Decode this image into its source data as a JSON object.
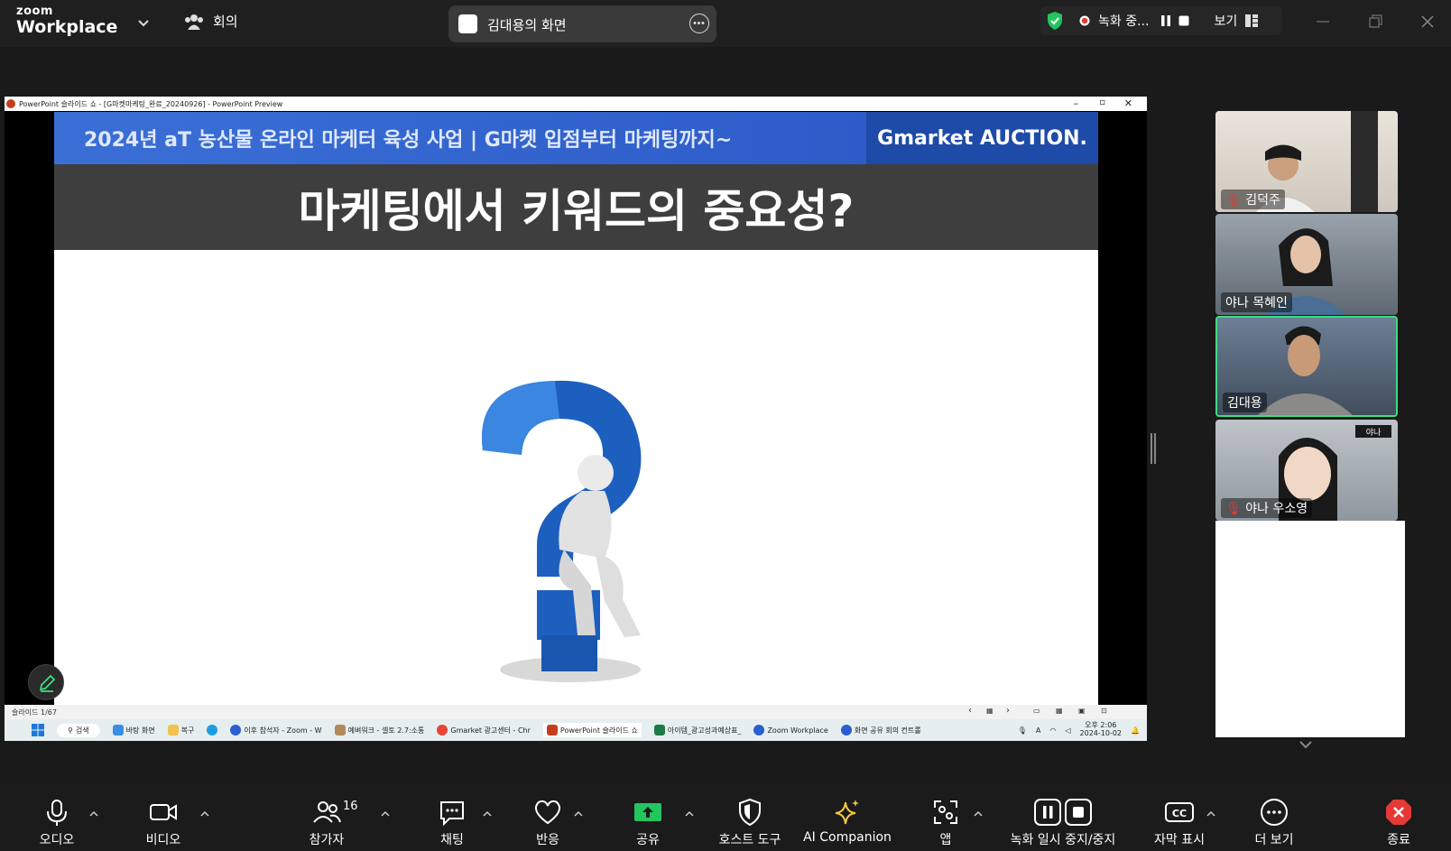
{
  "app": {
    "logo_top": "zoom",
    "logo_bottom": "Workplace",
    "meeting_label": "회의"
  },
  "share": {
    "label": "김대용의 화면"
  },
  "recording": {
    "label": "녹화 중...",
    "view_label": "보기"
  },
  "ppt": {
    "window_title": "PowerPoint 슬라이드 쇼 - [G마켓마케팅_완료_20240926] - PowerPoint Preview",
    "banner_text": "2024년 aT 농산물 온라인 마케터 육성 사업   |   G마켓 입점부터 마케팅까지~",
    "brand_text": "Gmarket AUCTION.",
    "heading": "마케팅에서 키워드의 중요성?",
    "slide_counter": "슬라이드 1/67",
    "clock_time": "오후 2:06",
    "clock_date": "2024-10-02"
  },
  "taskbar": {
    "search": "검색",
    "items": [
      "바탕 화면",
      "복구",
      "",
      "이후 참석자 - Zoom - W",
      "예벼워크 - 셀토 2.7:소통",
      "Gmarket 광고센터 - Chr",
      "PowerPoint 슬라이드 쇼",
      "아이템_광고성과예상표_",
      "Zoom Workplace",
      "화면 공유 회의 컨트롤"
    ]
  },
  "participants": [
    {
      "name": "김덕주",
      "muted": true
    },
    {
      "name": "야나 목혜인",
      "muted": false
    },
    {
      "name": "김대용",
      "muted": false,
      "active": true
    },
    {
      "name": "야나 우소영",
      "muted": true
    }
  ],
  "toolbar": {
    "audio": "오디오",
    "video": "비디오",
    "participants": "참가자",
    "participants_count": "16",
    "chat": "채팅",
    "react": "반응",
    "share": "공유",
    "host_tools": "호스트 도구",
    "ai": "AI Companion",
    "apps": "앱",
    "record": "녹화 일시 중지/중지",
    "captions": "자막 표시",
    "more": "더 보기",
    "end": "종료"
  },
  "colors": {
    "share_green": "#22c55e",
    "active_border": "#3ddc84",
    "end_red": "#e53935",
    "ai_gold": "#f6c744"
  }
}
